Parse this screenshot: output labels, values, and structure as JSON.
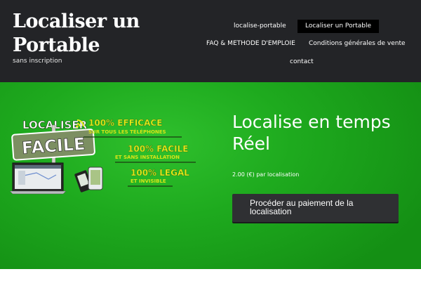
{
  "site": {
    "title": "Localiser un Portable",
    "tagline": "sans inscription"
  },
  "nav": {
    "items": [
      {
        "label": "localise-portable",
        "active": false
      },
      {
        "label": "Localiser un Portable",
        "active": true
      },
      {
        "label": "FAQ & METHODE D'EMPLOIE",
        "active": false
      },
      {
        "label": "Conditions générales de vente",
        "active": false
      },
      {
        "label": "contact",
        "active": false
      }
    ]
  },
  "promo": {
    "logo_text": "LOCALISER",
    "sign_text": "FACILE",
    "claims": [
      {
        "headline": "100% EFFICACE",
        "sub": "SUR TOUS LES TÉLÉPHONES"
      },
      {
        "headline": "100% FACILE",
        "sub": "ET SANS INSTALLATION"
      },
      {
        "headline": "100% LEGAL",
        "sub": "ET INVISIBLE"
      }
    ]
  },
  "hero": {
    "title": "Localise en temps Réel",
    "price": "2.00 (€) par localisation",
    "pay_button": "Procéder au paiement de la localisation"
  },
  "colors": {
    "header_bg": "#232427",
    "hero_green": "#1eaa1e",
    "button_bg": "#2f3033",
    "promo_yellow": "#e8f018"
  }
}
